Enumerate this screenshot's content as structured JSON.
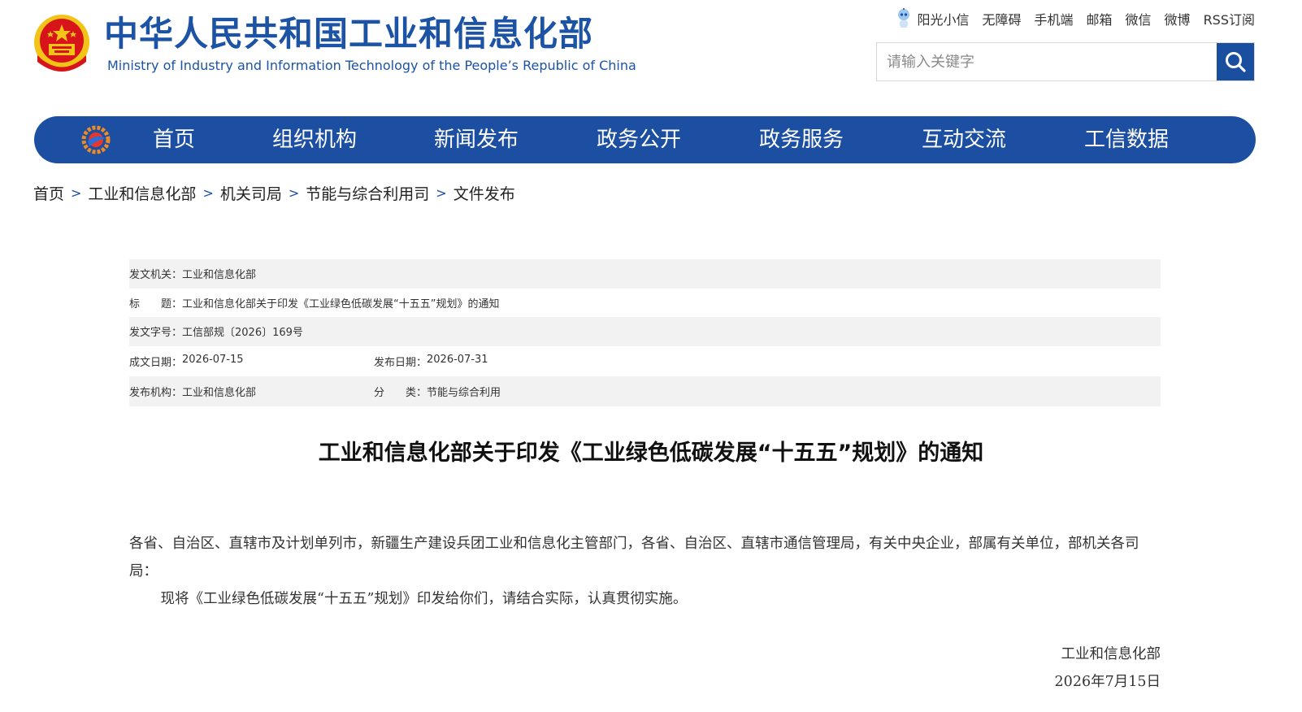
{
  "header": {
    "title_cn": "中华人民共和国工业和信息化部",
    "title_en": "Ministry of Industry and Information Technology of the People’s Republic of China",
    "top_links": [
      "阳光小信",
      "无障碍",
      "手机端",
      "邮箱",
      "微信",
      "微博",
      "RSS订阅"
    ],
    "search_placeholder": "请输入关键字"
  },
  "nav": {
    "items": [
      "首页",
      "组织机构",
      "新闻发布",
      "政务公开",
      "政务服务",
      "互动交流",
      "工信数据"
    ]
  },
  "breadcrumb": [
    "首页",
    "工业和信息化部",
    "机关司局",
    "节能与综合利用司",
    "文件发布"
  ],
  "info": {
    "issuer_label": "发文机关：",
    "issuer": "工业和信息化部",
    "title_label": "标　　题：",
    "title": "工业和信息化部关于印发《工业绿色低碳发展“十五五”规划》的通知",
    "doc_no_label": "发文字号：",
    "doc_no": "工信部规〔2026〕169号",
    "written_label": "成文日期：",
    "written": "2026-07-15",
    "published_label": "发布日期：",
    "published": "2026-07-31",
    "org_label": "发布机构：",
    "org": "工业和信息化部",
    "category_label": "分　　类：",
    "category": "节能与综合利用"
  },
  "article": {
    "title": "工业和信息化部关于印发《工业绿色低碳发展“十五五”规划》的通知",
    "salutation": "各省、自治区、直辖市及计划单列市，新疆生产建设兵团工业和信息化主管部门，各省、自治区、直辖市通信管理局，有关中央企业，部属有关单位，部机关各司局：",
    "paragraph": "现将《工业绿色低碳发展“十五五”规划》印发给你们，请结合实际，认真贯彻实施。",
    "signature": "工业和信息化部",
    "date": "2026年7月15日"
  },
  "colors": {
    "brand_blue": "#1c4fa1",
    "emblem_red": "#d7141a",
    "emblem_gold": "#f2c418"
  }
}
